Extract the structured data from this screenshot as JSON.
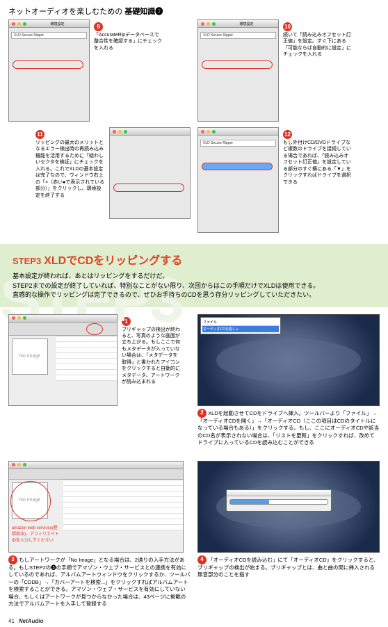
{
  "header": {
    "pre": "ネットオーディオを楽しむための",
    "main": "基礎知識",
    "num": "❷"
  },
  "s9": {
    "num": "9",
    "cap": "「AccurateRipデータベースで整合性を確認する」にチェックを入れる"
  },
  "s10": {
    "num": "10",
    "cap": "続いて「読み込みオフセット訂正値」を設定。すぐ下にある「可能ならば自動的に設定」にチェックを入れる"
  },
  "s11": {
    "num": "11",
    "cap": "リッピングの最大のメリットとなるエラー検出時の再読み込み機能を活用するために「疑わしいセクタを検証」にチェックを入れる。これでXLDの基本設定は完了なので、ウィンドウ右上の「×（赤い●で表示されている部分）」をクリックし、環境設定を終了する"
  },
  "s12": {
    "num": "12",
    "cap": "もし外付けCD/DVDドライブなど複数のドライブを接続している場合であれば、「読み込みオフセット訂正値」を設定している部分のすぐ横にある「▼」をクリックすればドライブを選択できる"
  },
  "step": {
    "label": "STEP3",
    "title": "XLDでCDをリッピングする",
    "text1": "基本設定が終われば、あとはリッピングをするだけだ。",
    "text2": "STEP2までの設定が終了していれば、特別なことがない限り、次回からはこの手順だけでXLDは使用できる。",
    "text3": "直感的な操作でリッピングは完了できるので、ぜひお手持ちのCDを思う存分リッピングしていただきたい。",
    "bg": "STEP3"
  },
  "b1": {
    "num": "1",
    "cap": "ブリギャップの検出が終わると、写真のような画面が立ち上がる。もしここで何もメタデータが入っていない場合は、「メタデータを取得」と書かれたアイコンをクリックすると自動的にメタデータ、アートワークが読み込まれる",
    "noimg": "No Image"
  },
  "b2": {
    "num": "2",
    "cap": "XLDを起動させてCDをドライブへ挿入。ツールバーより「ファイル」→「オーディオCDを開く」→「オーディオCD（ここの項目はCDのタイトルになっている場合もある）」をクリックする。もし、ここにオーディオCDや該当のCD名が表示されない場合は、「リストを更新」をクリックすれば、改めてドライブに入っているCDを読み込むことができる"
  },
  "b3": {
    "num": "3",
    "cap": "もしアートワークが「No Image」となる場合は、2通りの入手方法がある。もしSTEP2の❺の手順でアマゾン・ウェブ・サービスとの連携を有効にしているのであれば、アルバムアートウィンドウをクリックするか、ツールバーの「CDDB」→「カバーアートを検索...」をクリックすればアルバムアートを検索することができる。アマゾン・ウェブ・サービスを有効にしていない場合、もしくはアートワークが見つからなかった場合は、43ページに掲載の方法でアルバムアートを入手して登録する",
    "noimg": "No Image",
    "redtext": "amazon web services(登録商法)、アフィリエイトIDを入力してください"
  },
  "b4": {
    "num": "4",
    "cap": "「オーディオCDを読み込む」にて「オーディオCD」をクリックすると、ブリギャップの検出が始まる。ブリギャップとは、曲と曲の間に挿入される無音部分のことを指す"
  },
  "footer": {
    "page": "41",
    "mag": "NetAudio"
  },
  "win": {
    "title": "XLD Secure Ripper",
    "pref": "環境設定"
  }
}
